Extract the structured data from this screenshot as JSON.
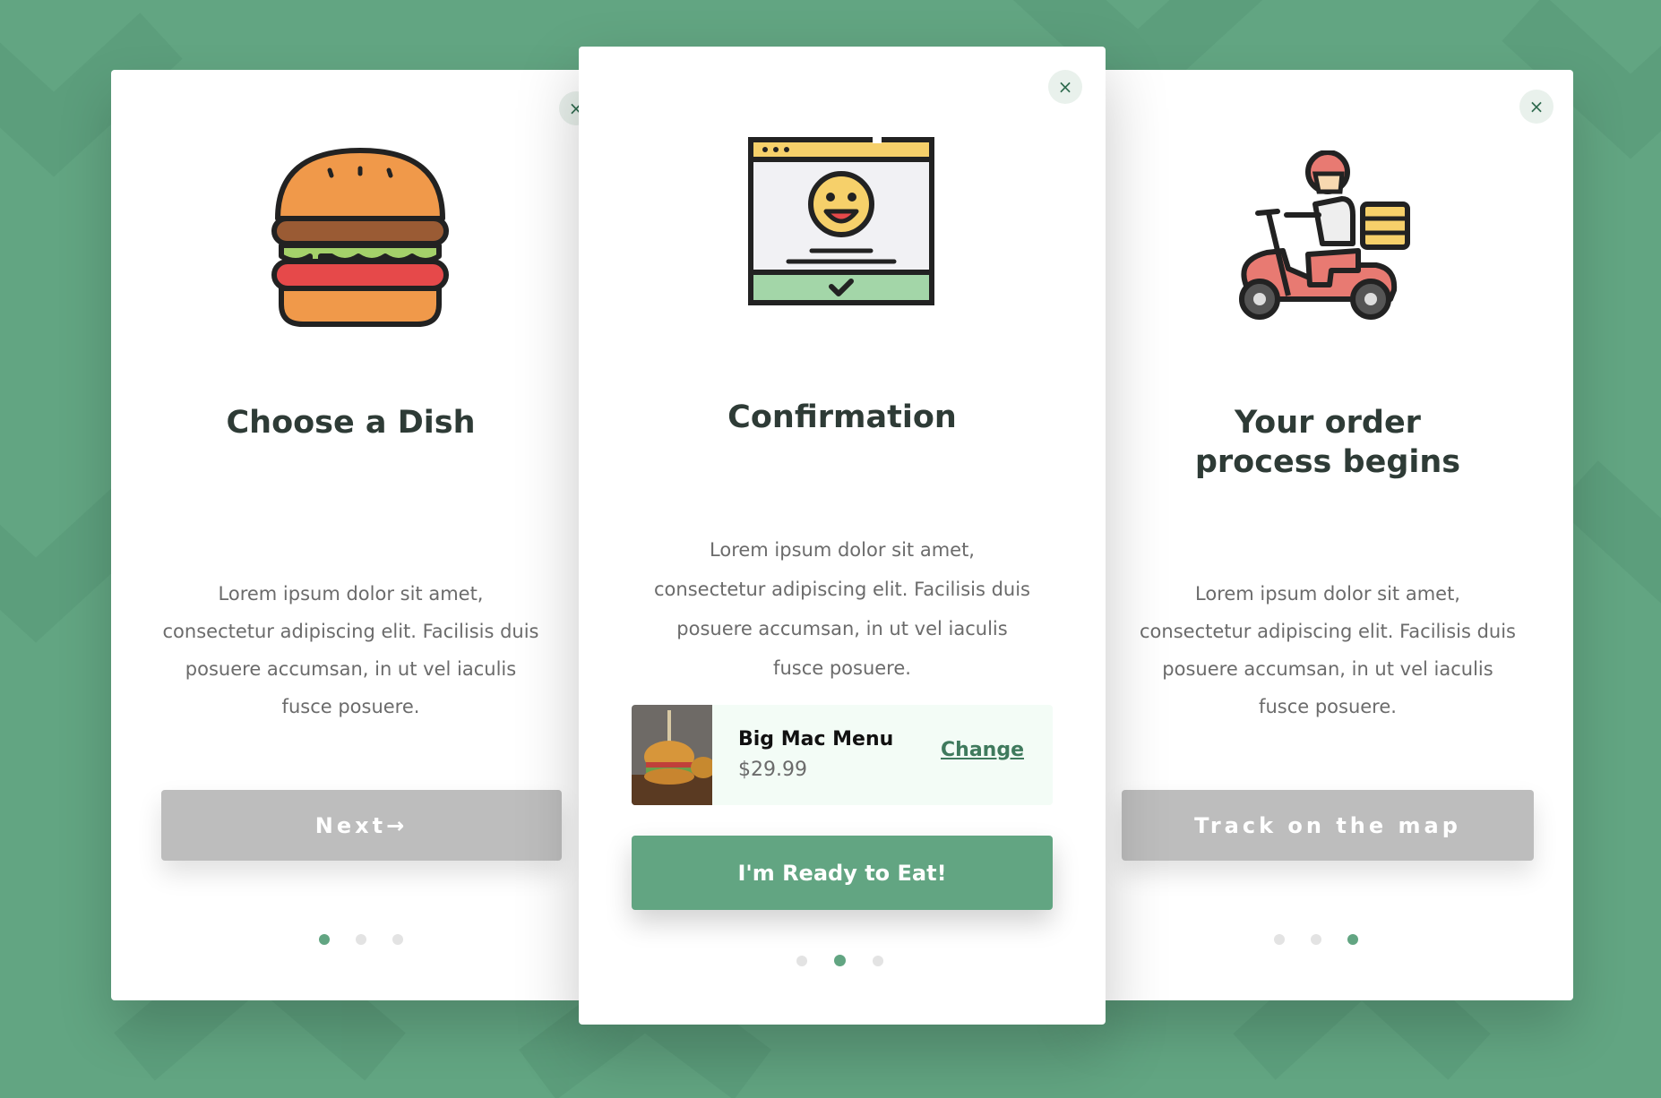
{
  "colors": {
    "background": "#62a582",
    "accent": "#62a582",
    "disabled_button": "#bdbdbd",
    "title": "#2e3b36"
  },
  "cards": [
    {
      "icon": "burger-icon",
      "title": "Choose a Dish",
      "body_lines": [
        "Lorem ipsum dolor sit amet,",
        "consectetur adipiscing elit. Facilisis duis",
        "posuere accumsan, in ut vel iaculis",
        "fusce posuere."
      ],
      "button_label": "Next→",
      "close": "×"
    },
    {
      "icon": "browser-confirmation-icon",
      "title": "Confirmation",
      "body_lines": [
        "Lorem ipsum dolor sit amet,",
        "consectetur adipiscing elit. Facilisis duis",
        "posuere accumsan, in ut vel iaculis",
        "fusce posuere."
      ],
      "order": {
        "name": "Big Mac Menu",
        "price": "$29.99",
        "change_label": "Change"
      },
      "button_label": "I'm Ready to Eat!",
      "close": "×"
    },
    {
      "icon": "delivery-scooter-icon",
      "title_lines": [
        "Your order",
        "process begins"
      ],
      "body_lines": [
        "Lorem ipsum dolor sit amet,",
        "consectetur adipiscing elit. Facilisis duis",
        "posuere accumsan, in ut vel iaculis",
        "fusce posuere."
      ],
      "button_label": "Track on the map",
      "close": "×"
    }
  ],
  "pagination": {
    "total": 3,
    "active_left": 1,
    "active_middle": 2,
    "active_right": 3
  }
}
